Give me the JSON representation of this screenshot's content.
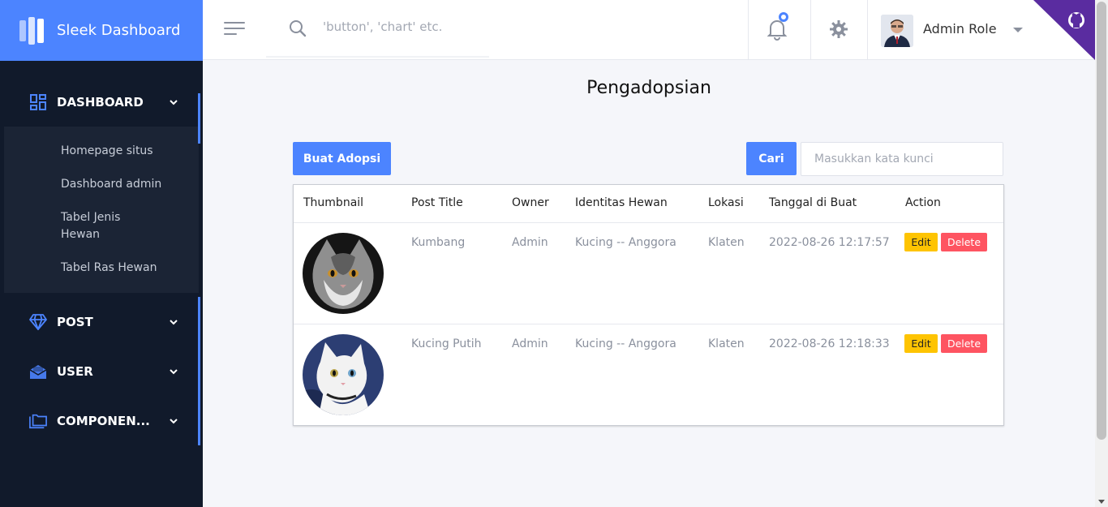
{
  "brand": {
    "name": "Sleek Dashboard"
  },
  "sidebar": {
    "dashboard": {
      "label": "DASHBOARD",
      "items": [
        "Homepage situs",
        "Dashboard admin",
        "Tabel Jenis Hewan",
        "Tabel Ras Hewan"
      ]
    },
    "post": {
      "label": "POST"
    },
    "user": {
      "label": "USER"
    },
    "components": {
      "label": "COMPONEN..."
    }
  },
  "header": {
    "search_placeholder": "'button', 'chart' etc.",
    "user_name": "Admin Role"
  },
  "main": {
    "title": "Pengadopsian",
    "add_button": "Buat Adopsi",
    "search_button": "Cari",
    "keyword_placeholder": "Masukkan kata kunci"
  },
  "table": {
    "headers": [
      "Thumbnail",
      "Post Title",
      "Owner",
      "Identitas Hewan",
      "Lokasi",
      "Tanggal di Buat",
      "Action"
    ],
    "rows": [
      {
        "title": "Kumbang",
        "owner": "Admin",
        "identity": "Kucing -- Anggora",
        "location": "Klaten",
        "created": "2022-08-26 12:17:57",
        "edit": "Edit",
        "delete": "Delete"
      },
      {
        "title": "Kucing Putih",
        "owner": "Admin",
        "identity": "Kucing -- Anggora",
        "location": "Klaten",
        "created": "2022-08-26 12:18:33",
        "edit": "Edit",
        "delete": "Delete"
      }
    ]
  },
  "colors": {
    "brand": "#4c84ff",
    "sidebar_bg": "#111a2b",
    "edit": "#fec402",
    "delete": "#fe5461",
    "corner": "#5a2ca0"
  }
}
